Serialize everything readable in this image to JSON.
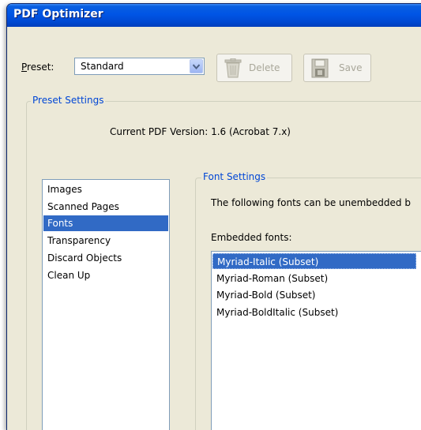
{
  "window": {
    "title": "PDF Optimizer"
  },
  "toolbar": {
    "preset_label": "Preset:",
    "preset_value": "Standard",
    "delete_label": "Delete",
    "save_label": "Save"
  },
  "preset_settings": {
    "group_title": "Preset Settings",
    "version_text": "Current PDF Version: 1.6 (Acrobat 7.x)"
  },
  "categories": [
    "Images",
    "Scanned Pages",
    "Fonts",
    "Transparency",
    "Discard Objects",
    "Clean Up"
  ],
  "selected_category": "Fonts",
  "font_settings": {
    "group_title": "Font Settings",
    "description": "The following fonts can be unembedded b",
    "embedded_label": "Embedded fonts:",
    "embedded_fonts": [
      "Myriad-Italic (Subset)",
      "Myriad-Roman (Subset)",
      "Myriad-Bold (Subset)",
      "Myriad-BoldItalic (Subset)"
    ],
    "selected_font": "Myriad-Italic (Subset)"
  },
  "colors": {
    "title_bar": "#0055e5",
    "selection": "#316ac5",
    "group_title": "#0046d5",
    "dialog_bg": "#ece9d8"
  },
  "icons": [
    "dropdown-arrow-icon",
    "trash-icon",
    "floppy-disk-icon"
  ]
}
